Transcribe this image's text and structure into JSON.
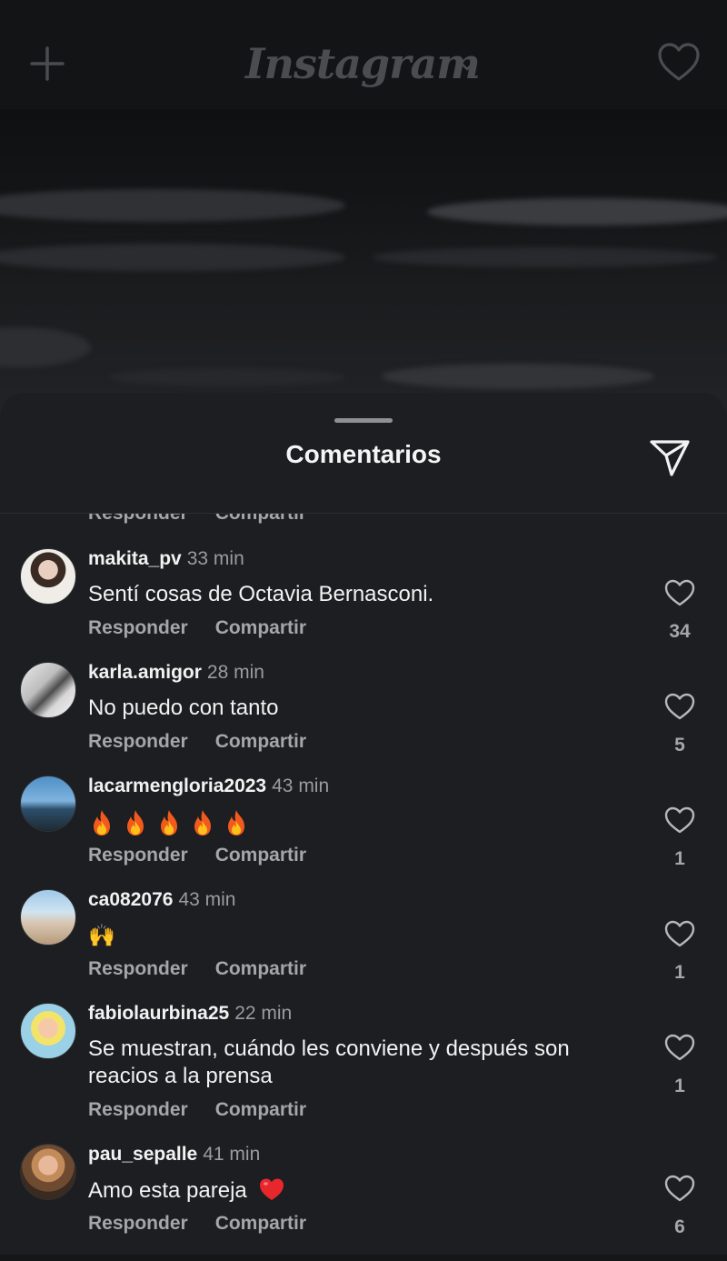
{
  "app": {
    "logo_text": "Instagram"
  },
  "sheet": {
    "title": "Comentarios",
    "partial_row": {
      "reply_label": "Responder",
      "share_label": "Compartir"
    }
  },
  "actions": {
    "reply_label": "Responder",
    "share_label": "Compartir"
  },
  "comments": [
    {
      "username": "makita_pv",
      "time": "33 min",
      "text": "Sentí cosas de Octavia Bernasconi.",
      "likes": "34"
    },
    {
      "username": "karla.amigor",
      "time": "28 min",
      "text": "No puedo con tanto",
      "likes": "5"
    },
    {
      "username": "lacarmengloria2023",
      "time": "43 min",
      "text": "",
      "emoji": "fire x5",
      "likes": "1"
    },
    {
      "username": "ca082076",
      "time": "43 min",
      "text": "🙌",
      "likes": "1"
    },
    {
      "username": "fabiolaurbina25",
      "time": "22 min",
      "text": "Se muestran, cuándo les conviene y después son reacios a la prensa",
      "likes": "1"
    },
    {
      "username": "pau_sepalle",
      "time": "41 min",
      "text": "Amo esta pareja",
      "emoji": "red heart",
      "likes": "6"
    }
  ],
  "colors": {
    "sheet_bg": "#1c1e21",
    "secondary_text": "#a4a6ab",
    "primary_text": "#f2f2f2"
  }
}
